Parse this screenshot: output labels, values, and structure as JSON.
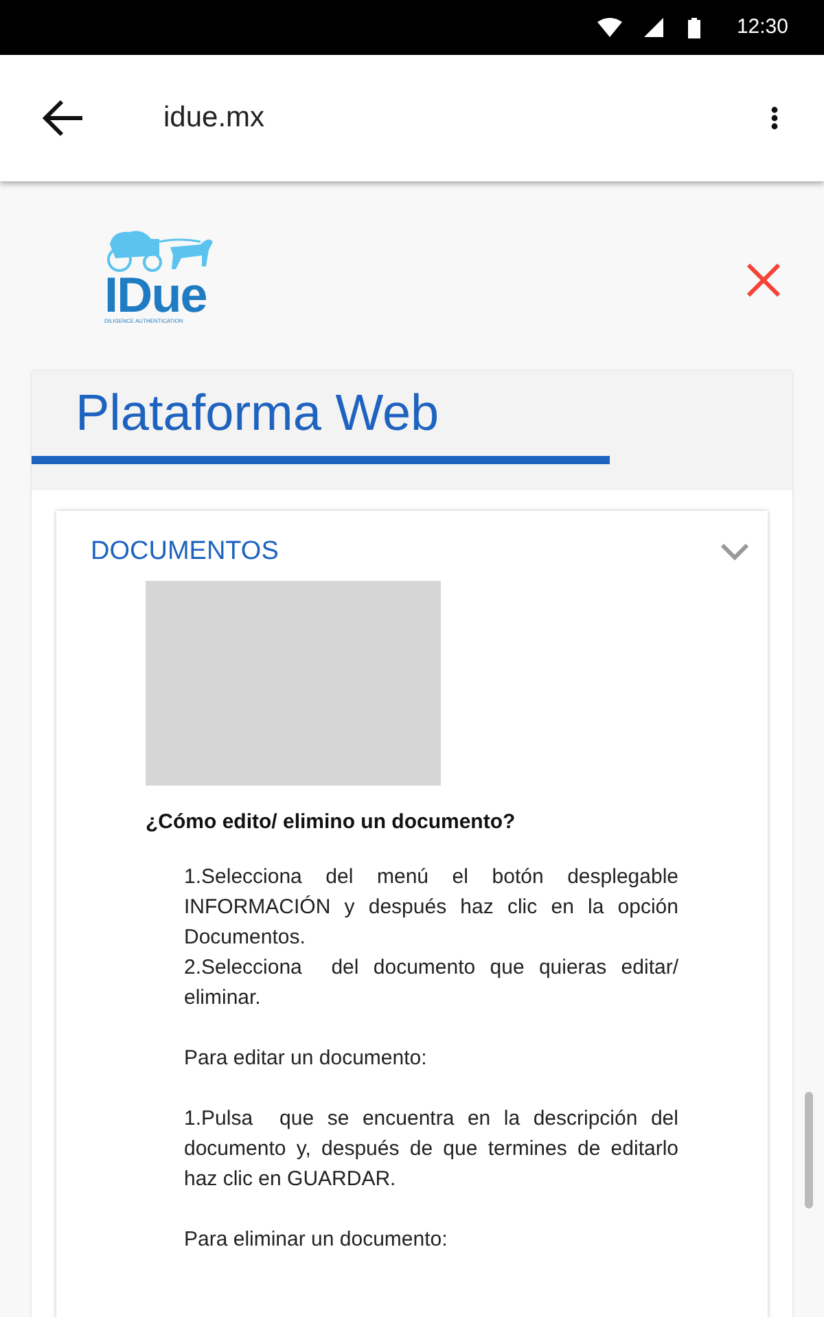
{
  "status_bar": {
    "time": "12:30"
  },
  "app_bar": {
    "title": "idue.mx"
  },
  "logo": {
    "wordmark": "IDue",
    "tagline": "DILIGENCE AUTHENTICATION"
  },
  "page": {
    "title": "Plataforma Web"
  },
  "section": {
    "title": "DOCUMENTOS",
    "expanded": true,
    "question": "¿Cómo edito/ elimino un documento?",
    "paragraphs": [
      {
        "lines": [
          "1.Selecciona del menú el botón desplegable INFORMACIÓN y después haz clic en la opción Documentos.",
          "2.Selecciona  del documento que quieras editar/ eliminar."
        ]
      },
      {
        "lines": [
          "Para editar un documento:"
        ]
      },
      {
        "lines": [
          "1.Pulsa  que se encuentra en la descripción del documento y, después de que termines de editarlo haz clic en GUARDAR."
        ]
      },
      {
        "lines": [
          "Para eliminar un documento:"
        ]
      }
    ]
  }
}
